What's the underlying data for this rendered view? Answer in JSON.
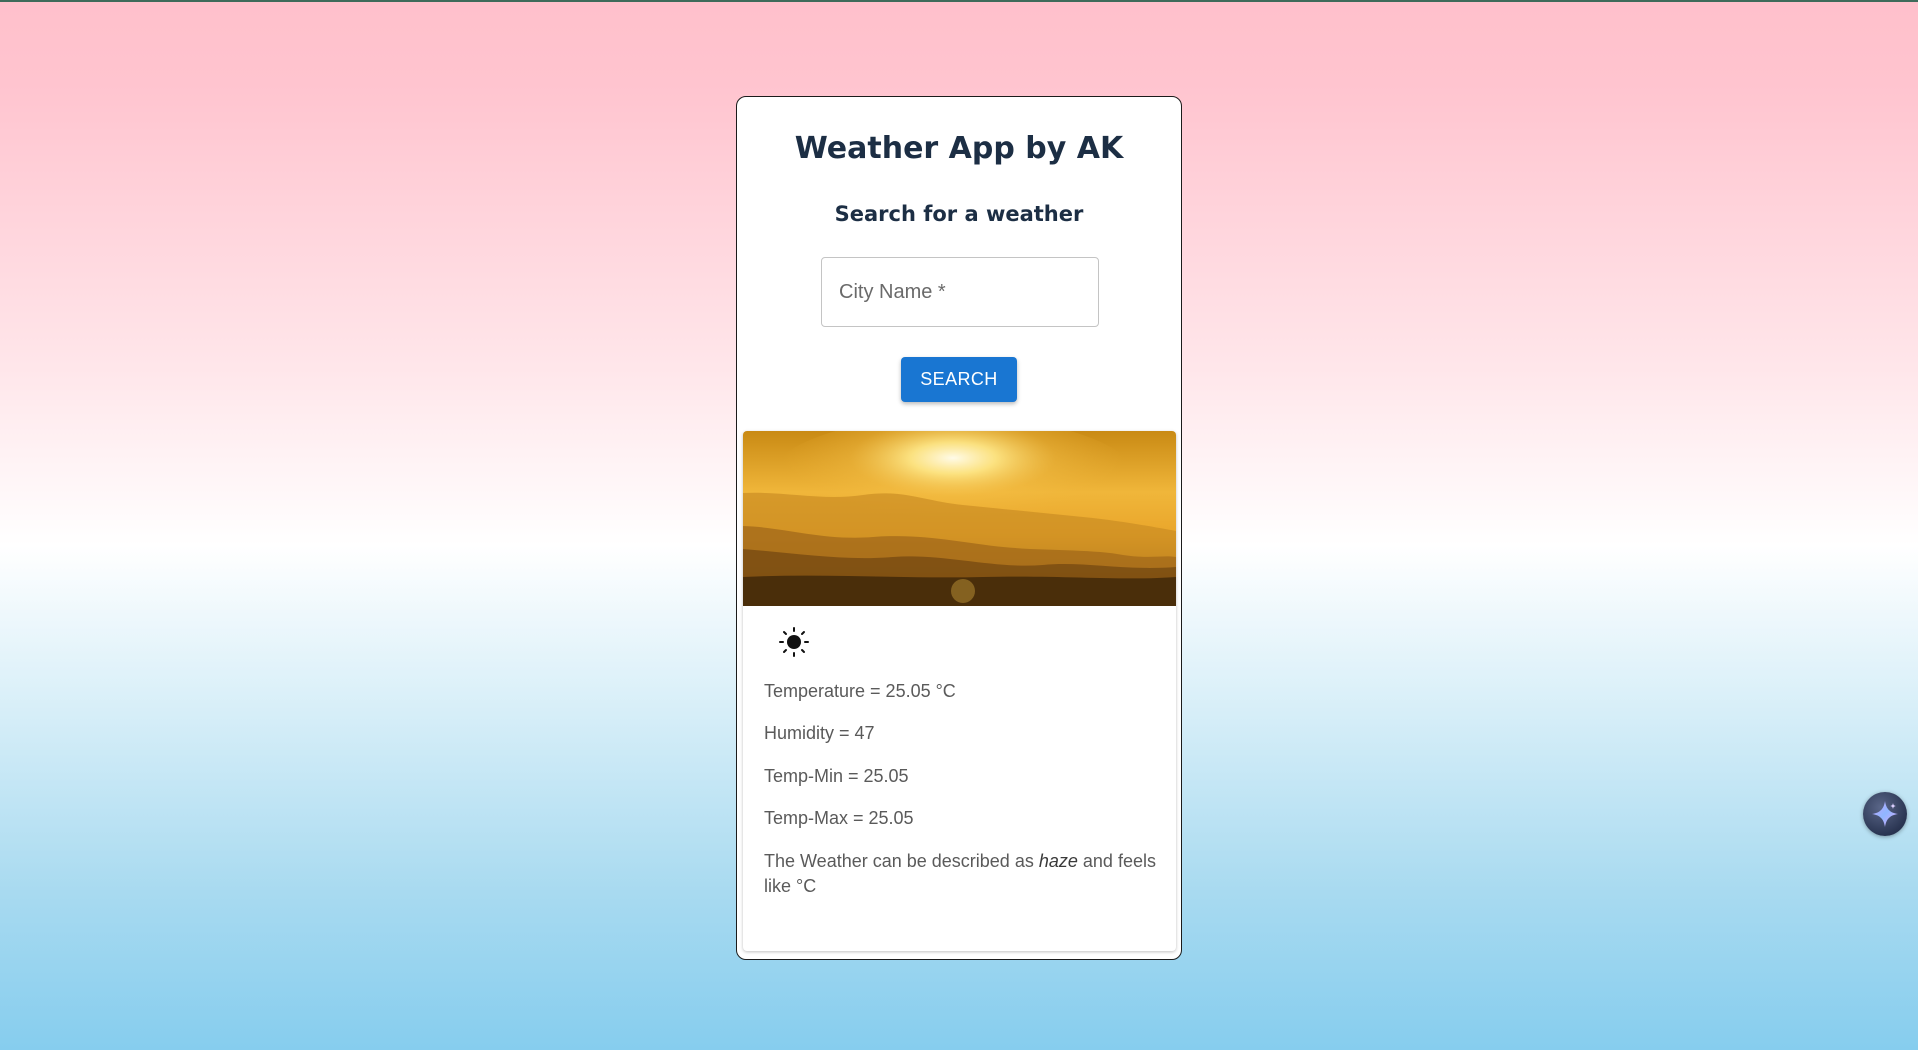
{
  "app": {
    "title": "Weather App by AK",
    "subtitle": "Search for a weather"
  },
  "search": {
    "placeholder": "City Name *",
    "value": "",
    "button_label": "SEARCH"
  },
  "weather": {
    "icon": "sun-icon",
    "temperature_text": "Temperature = 25.05 °C",
    "humidity_text": "Humidity = 47",
    "temp_min_text": "Temp-Min = 25.05",
    "temp_max_text": "Temp-Max = 25.05",
    "description_prefix": "The Weather can be described as",
    "description": "haze",
    "description_suffix": "and feels like °C"
  },
  "floating_button": {
    "icon": "sparkle-icon"
  },
  "colors": {
    "accent": "#1976d2",
    "heading": "#1c2e44",
    "body_text": "#5a5a5a"
  }
}
